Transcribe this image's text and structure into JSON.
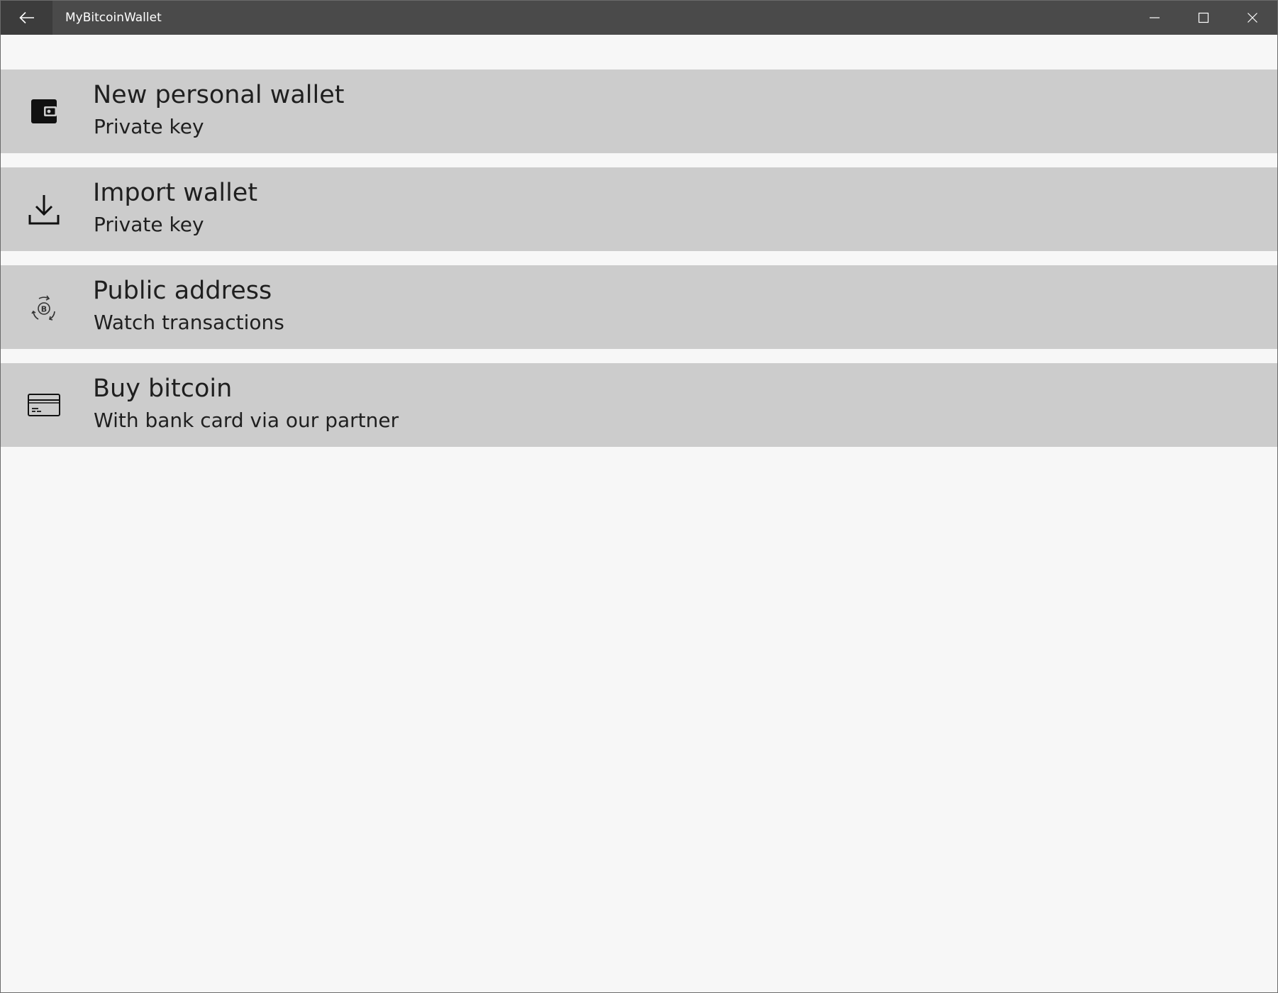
{
  "window": {
    "title": "MyBitcoinWallet",
    "back_icon": "back-arrow-icon",
    "controls": {
      "minimize_icon": "minimize-icon",
      "maximize_icon": "maximize-icon",
      "close_icon": "close-icon"
    }
  },
  "menu": {
    "items": [
      {
        "title": "New personal wallet",
        "subtitle": "Private key",
        "icon": "wallet-icon"
      },
      {
        "title": "Import wallet",
        "subtitle": "Private key",
        "icon": "download-icon"
      },
      {
        "title": "Public address",
        "subtitle": "Watch transactions",
        "icon": "bitcoin-cycle-icon"
      },
      {
        "title": "Buy bitcoin",
        "subtitle": "With bank card via our partner",
        "icon": "credit-card-icon"
      }
    ]
  },
  "colors": {
    "titlebar": "#4a4a4a",
    "back_button": "#3c3c3c",
    "item_background": "#cccccc",
    "page_background": "#f7f7f7",
    "text": "#1f1f1f"
  }
}
